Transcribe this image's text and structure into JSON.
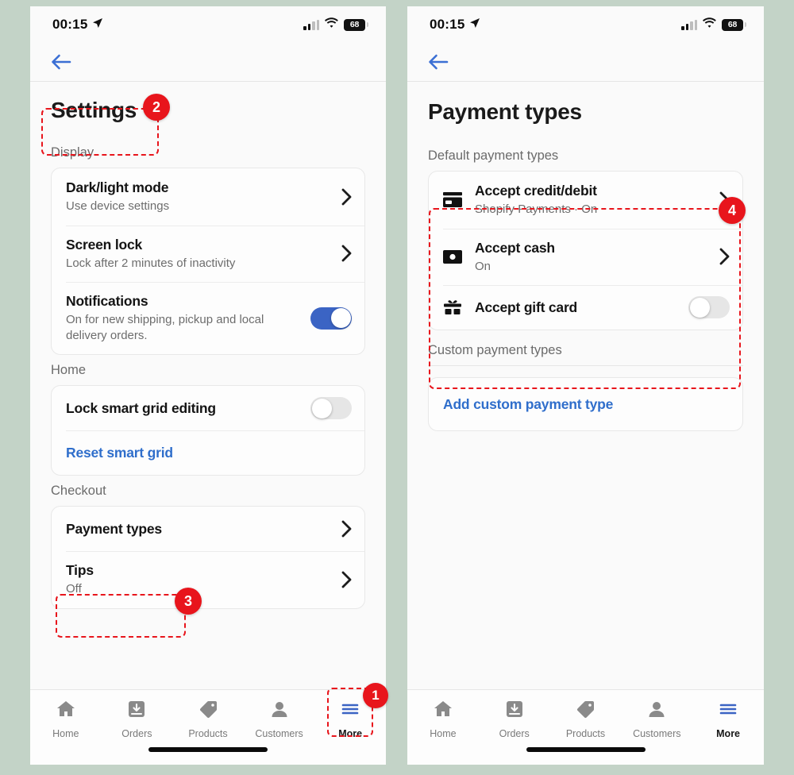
{
  "background_color": "#c3d3c7",
  "accent_blue": "#2f6ecb",
  "annotation_color": "#e8151c",
  "status_bar": {
    "time": "00:15",
    "location_icon": "location-arrow-icon",
    "cellular_icon": "cellular-bars-icon",
    "wifi_icon": "wifi-icon",
    "battery_level": "68"
  },
  "left_screen": {
    "back_icon": "back-arrow-icon",
    "title": "Settings",
    "sections": [
      {
        "label": "Display",
        "rows": [
          {
            "icon": null,
            "title": "Dark/light mode",
            "subtitle": "Use device settings",
            "control": "chevron"
          },
          {
            "icon": null,
            "title": "Screen lock",
            "subtitle": "Lock after 2 minutes of inactivity",
            "control": "chevron"
          },
          {
            "icon": null,
            "title": "Notifications",
            "subtitle": "On for new shipping, pickup and local delivery orders.",
            "control": "toggle-on"
          }
        ]
      },
      {
        "label": "Home",
        "rows": [
          {
            "icon": null,
            "title": "Lock smart grid editing",
            "subtitle": null,
            "control": "toggle-off"
          },
          {
            "icon": null,
            "title": "Reset smart grid",
            "subtitle": null,
            "control": "link"
          }
        ]
      },
      {
        "label": "Checkout",
        "rows": [
          {
            "icon": null,
            "title": "Payment types",
            "subtitle": null,
            "control": "chevron"
          },
          {
            "icon": null,
            "title": "Tips",
            "subtitle": "Off",
            "control": "chevron"
          }
        ]
      }
    ],
    "tabs": [
      {
        "label": "Home",
        "icon": "house-icon",
        "active": false
      },
      {
        "label": "Orders",
        "icon": "inbox-download-icon",
        "active": false
      },
      {
        "label": "Products",
        "icon": "price-tag-icon",
        "active": false
      },
      {
        "label": "Customers",
        "icon": "person-icon",
        "active": false
      },
      {
        "label": "More",
        "icon": "hamburger-menu-icon",
        "active": true
      }
    ]
  },
  "right_screen": {
    "back_icon": "back-arrow-icon",
    "title": "Payment types",
    "sections": [
      {
        "label": "Default payment types",
        "rows": [
          {
            "icon": "credit-card-icon",
            "title": "Accept credit/debit",
            "subtitle": "Shopify Payments · On",
            "control": "chevron"
          },
          {
            "icon": "cash-bill-icon",
            "title": "Accept cash",
            "subtitle": "On",
            "control": "chevron"
          },
          {
            "icon": "gift-card-icon",
            "title": "Accept gift card",
            "subtitle": null,
            "control": "toggle-off"
          }
        ]
      },
      {
        "label": "Custom payment types",
        "rows": [
          {
            "icon": null,
            "title": "Add custom payment type",
            "subtitle": null,
            "control": "link"
          }
        ]
      }
    ],
    "tabs": [
      {
        "label": "Home",
        "icon": "house-icon",
        "active": false
      },
      {
        "label": "Orders",
        "icon": "inbox-download-icon",
        "active": false
      },
      {
        "label": "Products",
        "icon": "price-tag-icon",
        "active": false
      },
      {
        "label": "Customers",
        "icon": "person-icon",
        "active": false
      },
      {
        "label": "More",
        "icon": "hamburger-menu-icon",
        "active": true
      }
    ]
  },
  "annotations": [
    {
      "number": "1",
      "target": "more-tab-left"
    },
    {
      "number": "2",
      "target": "settings-title"
    },
    {
      "number": "3",
      "target": "payment-types-row"
    },
    {
      "number": "4",
      "target": "default-payment-types-card"
    }
  ]
}
